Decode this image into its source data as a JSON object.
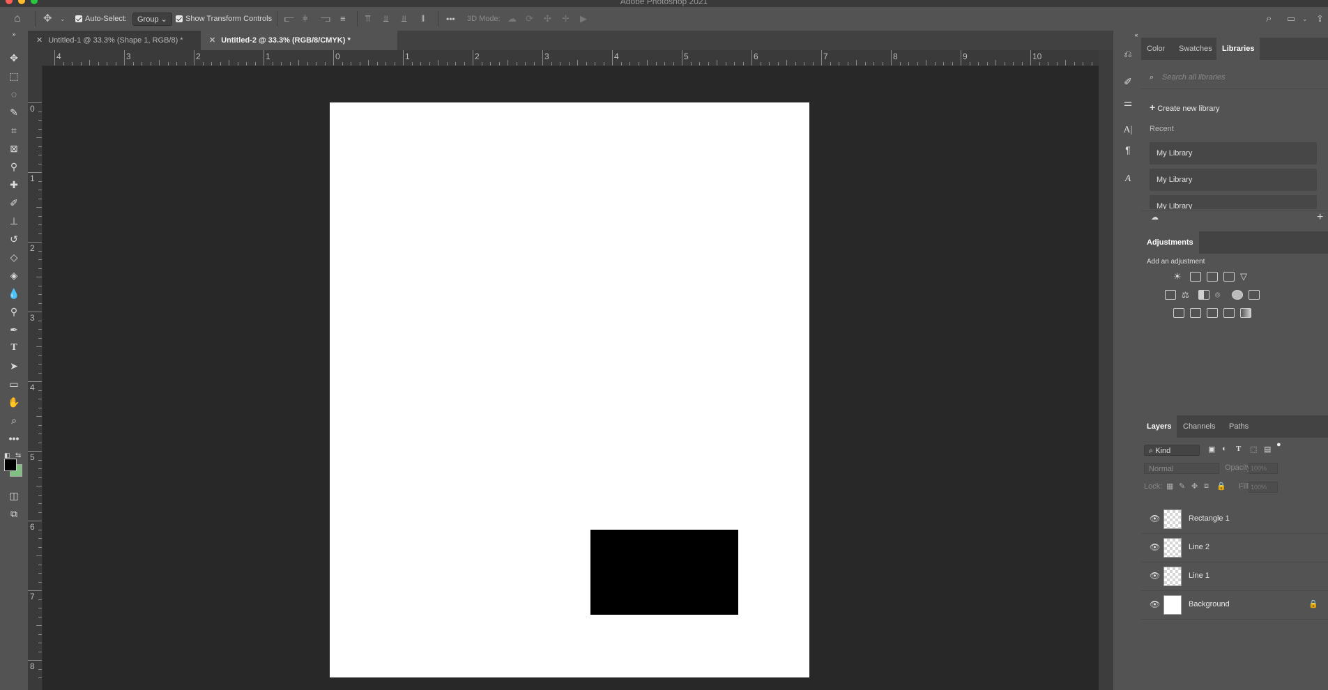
{
  "app": {
    "title": "Adobe Photoshop 2021"
  },
  "options_bar": {
    "auto_select_label": "Auto-Select:",
    "auto_select_value": "Group",
    "show_transform_label": "Show Transform Controls",
    "three_d_mode_label": "3D Mode:",
    "more_label": "•••"
  },
  "document_tabs": [
    {
      "label": "Untitled-1 @ 33.3% (Shape 1, RGB/8) *",
      "active": false
    },
    {
      "label": "Untitled-2 @ 33.3% (RGB/8/CMYK) *",
      "active": true
    }
  ],
  "rulers": {
    "horizontal": [
      "4",
      "3",
      "2",
      "1",
      "0",
      "1",
      "2",
      "3",
      "4",
      "5",
      "6",
      "7",
      "8",
      "9",
      "10"
    ],
    "vertical": [
      "0",
      "1",
      "2",
      "3",
      "4",
      "5",
      "6",
      "7",
      "8"
    ]
  },
  "libraries_panel": {
    "tabs": [
      "Color",
      "Swatches",
      "Libraries"
    ],
    "active_tab": "Libraries",
    "search_placeholder": "Search all libraries",
    "create_label": "Create new library",
    "recent_label": "Recent",
    "libraries": [
      "My Library",
      "My Library",
      "My Library"
    ]
  },
  "adjustments_panel": {
    "title": "Adjustments",
    "subtitle": "Add an adjustment"
  },
  "layers_panel": {
    "tabs": [
      "Layers",
      "Channels",
      "Paths"
    ],
    "active_tab": "Layers",
    "filter_value": "Kind",
    "blend_mode": "Normal",
    "opacity_label": "Opacity:",
    "opacity_value": "100%",
    "lock_label": "Lock:",
    "fill_label": "Fill:",
    "fill_value": "100%",
    "layers": [
      {
        "name": "Rectangle 1",
        "type": "shape"
      },
      {
        "name": "Line 2",
        "type": "shape"
      },
      {
        "name": "Line 1",
        "type": "shape"
      },
      {
        "name": "Background",
        "type": "background",
        "locked": true
      }
    ]
  },
  "colors": {
    "foreground": "#000000",
    "background": "#7fbf7f",
    "canvas_rect": "#000000"
  }
}
